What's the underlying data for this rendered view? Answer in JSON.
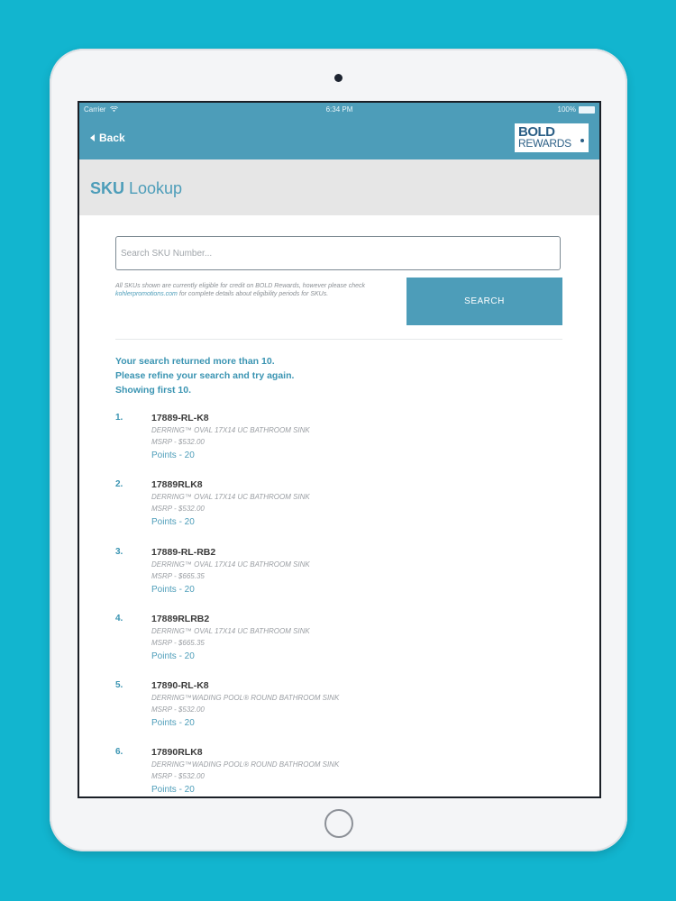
{
  "status_bar": {
    "carrier": "Carrier",
    "time": "6:34 PM",
    "battery": "100%"
  },
  "nav": {
    "back_label": "Back",
    "logo_line1": "BOLD",
    "logo_line2": "REWARDS"
  },
  "page": {
    "title_bold": "SKU",
    "title_rest": " Lookup"
  },
  "search": {
    "placeholder": "Search SKU Number...",
    "value": "",
    "button_label": "SEARCH",
    "disclaimer_pre": "All SKUs shown are currently eligible for credit on BOLD Rewards, however please check ",
    "disclaimer_link": "kohlerpromotions.com",
    "disclaimer_post": " for complete details about eligibility periods for SKUs."
  },
  "results": {
    "message_line1": "Your search returned more than 10.",
    "message_line2": "Please refine your search and try again.",
    "message_line3": "Showing first 10.",
    "items": [
      {
        "num": "1.",
        "sku": "17889-RL-K8",
        "desc": "DERRING™ OVAL 17X14 UC BATHROOM SINK",
        "msrp": "MSRP - $532.00",
        "points": "Points - 20"
      },
      {
        "num": "2.",
        "sku": "17889RLK8",
        "desc": "DERRING™ OVAL 17X14 UC BATHROOM SINK",
        "msrp": "MSRP - $532.00",
        "points": "Points - 20"
      },
      {
        "num": "3.",
        "sku": "17889-RL-RB2",
        "desc": "DERRING™ OVAL 17X14 UC BATHROOM SINK",
        "msrp": "MSRP - $665.35",
        "points": "Points - 20"
      },
      {
        "num": "4.",
        "sku": "17889RLRB2",
        "desc": "DERRING™ OVAL 17X14 UC BATHROOM SINK",
        "msrp": "MSRP - $665.35",
        "points": "Points - 20"
      },
      {
        "num": "5.",
        "sku": "17890-RL-K8",
        "desc": "DERRING™WADING POOL® ROUND BATHROOM SINK",
        "msrp": "MSRP - $532.00",
        "points": "Points - 20"
      },
      {
        "num": "6.",
        "sku": "17890RLK8",
        "desc": "DERRING™WADING POOL® ROUND BATHROOM SINK",
        "msrp": "MSRP - $532.00",
        "points": "Points - 20"
      }
    ]
  },
  "colors": {
    "background": "#12b5cf",
    "accent": "#4d9db9",
    "results_text": "#3a94b2"
  },
  "icons": [
    "wifi-icon",
    "battery-icon",
    "chevron-left-icon",
    "camera-icon",
    "home-button-icon"
  ]
}
